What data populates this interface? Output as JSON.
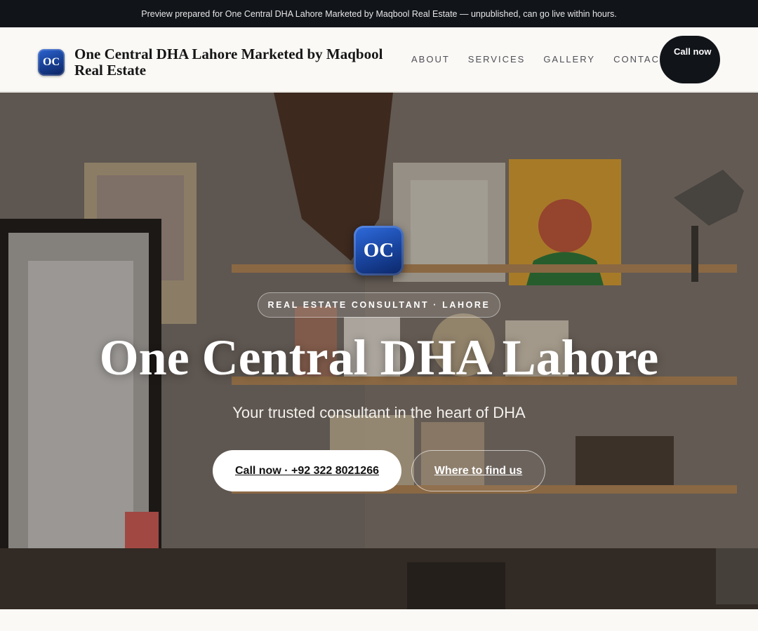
{
  "preview_banner": "Preview prepared for One Central DHA Lahore Marketed by Maqbool Real Estate — unpublished, can go live within hours.",
  "header": {
    "logo_text": "OC",
    "brand_name": "One Central DHA Lahore Marketed by Maqbool Real Estate",
    "nav": [
      "ABOUT",
      "SERVICES",
      "GALLERY",
      "CONTACT"
    ],
    "cta": "Call now"
  },
  "hero": {
    "logo_text": "OC",
    "badge": "REAL ESTATE CONSULTANT · LAHORE",
    "title": "One Central DHA Lahore",
    "subtitle": "Your trusted consultant in the heart of DHA",
    "primary_button": "Call now · +92 322 8021266",
    "secondary_button": "Where to find us"
  },
  "colors": {
    "accent_blue": "#1a47a3",
    "dark": "#111419",
    "page_bg": "#faf9f6"
  }
}
